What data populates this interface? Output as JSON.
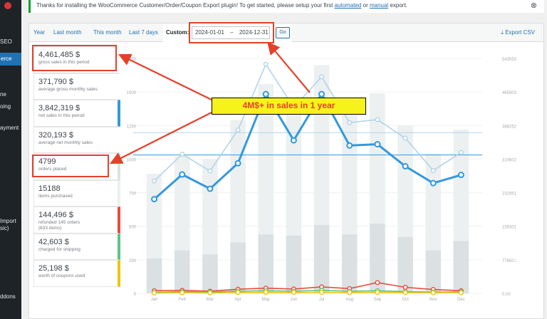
{
  "sidebar": {
    "items": [
      {
        "label": "SEO",
        "top": 54
      },
      {
        "label": "erce",
        "top": 74,
        "active": true
      },
      {
        "label": "ne",
        "top": 128
      },
      {
        "label": "oing",
        "top": 145
      },
      {
        "label": "ayment",
        "top": 175
      },
      {
        "label": "Import",
        "top": 306
      },
      {
        "label": "sic)",
        "top": 316
      },
      {
        "label": "ddons",
        "top": 412
      },
      {
        "label": "",
        "top": 438
      }
    ]
  },
  "notice": {
    "text_before": "Thanks for installing the WooCommerce Customer/Order/Coupon Export plugin! To get started, please setup your first ",
    "link1": "automated",
    "middle": " or ",
    "link2": "manual",
    "text_after": " export.",
    "dismiss": "⊗"
  },
  "range_tabs": [
    {
      "label": "Year"
    },
    {
      "label": "Last month"
    },
    {
      "label": "This month"
    },
    {
      "label": "Last 7 days"
    }
  ],
  "custom": {
    "label": "Custom:",
    "start": "2024-01-01",
    "separator": "–",
    "end": "2024-12-31",
    "go": "Go"
  },
  "export_label": "Export CSV",
  "legend": [
    {
      "value": "4,461,485 $",
      "label": "gross sales in this period",
      "color": "#ffffff"
    },
    {
      "value": "371,790 $",
      "label": "average gross monthly sales",
      "color": "#ffffff"
    },
    {
      "value": "3,842,319 $",
      "label": "net sales in this period",
      "color": "#3498db"
    },
    {
      "value": "320,193 $",
      "label": "average net monthly sales",
      "color": "#ffffff"
    },
    {
      "value": "4799",
      "label": "orders placed",
      "color": "#dbe1e3"
    },
    {
      "value": "15188",
      "label": "items purchased",
      "color": "#ecf0f1"
    },
    {
      "value": "144,496 $",
      "label": "refunded 145 orders",
      "label2": "(633 items)",
      "color": "#e74c3c"
    },
    {
      "value": "42,603 $",
      "label": "charged for shipping",
      "color": "#5cc488"
    },
    {
      "value": "25,198 $",
      "label": "worth of coupons used",
      "color": "#f1c40f"
    }
  ],
  "callout": "4M$+ in sales in 1 year",
  "chart_data": {
    "type": "bar",
    "categories": [
      "Jan",
      "Feb",
      "Mar",
      "Apr",
      "May",
      "Jun",
      "Jul",
      "Aug",
      "Sep",
      "Oct",
      "Nov",
      "Dec"
    ],
    "y_left_ticks": [
      "0",
      "250",
      "500",
      "750",
      "1000",
      "1250",
      "1500",
      "1750"
    ],
    "y_left_range": [
      0,
      1750
    ],
    "y_right_ticks": [
      "0.00",
      "77650.36",
      "155301.12",
      "232951.68",
      "310602.24",
      "388252.80",
      "465903.36",
      "543553.92"
    ],
    "y_right_range": [
      0,
      543553.92
    ],
    "series": [
      {
        "type": "bar",
        "color": "#dbe1e3",
        "values": [
          260,
          320,
          290,
          380,
          440,
          430,
          510,
          440,
          520,
          420,
          320,
          390
        ]
      },
      {
        "type": "bar",
        "color": "#ecf0f1",
        "values": [
          890,
          1020,
          1000,
          1290,
          1560,
          1380,
          1700,
          1350,
          1490,
          1250,
          1040,
          1220
        ]
      },
      {
        "type": "line",
        "color": "#b1d4ea",
        "values": [
          260000,
          322000,
          283000,
          378000,
          530000,
          430000,
          501000,
          395000,
          402000,
          359000,
          284000,
          326000
        ]
      },
      {
        "type": "line",
        "color": "#3498db",
        "values": [
          218000,
          275000,
          242000,
          301000,
          461000,
          354000,
          461000,
          342000,
          345000,
          294000,
          255000,
          274000
        ]
      },
      {
        "type": "line",
        "color": "#e74c3c",
        "values": [
          6000,
          7000,
          5000,
          9500,
          12000,
          10000,
          15000,
          11000,
          25000,
          14000,
          9000,
          6000
        ]
      },
      {
        "type": "line",
        "color": "#5cc488",
        "values": [
          2000,
          4000,
          3000,
          5000,
          6000,
          5000,
          7000,
          5000,
          6000,
          4000,
          3000,
          3000
        ]
      },
      {
        "type": "line",
        "color": "#f1c40f",
        "values": [
          1000,
          1500,
          1200,
          1800,
          2200,
          2000,
          2400,
          2000,
          2300,
          1800,
          1500,
          1600
        ]
      }
    ],
    "averages": [
      {
        "color": "#b1d4ea",
        "value": 371790
      },
      {
        "color": "#3498db",
        "value": 320193
      }
    ]
  }
}
